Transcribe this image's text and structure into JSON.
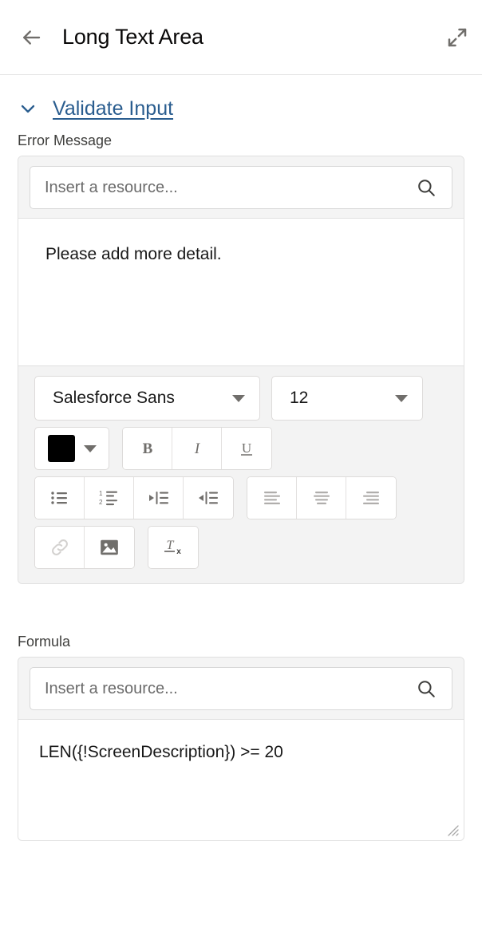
{
  "header": {
    "back_icon": "arrow-left-icon",
    "title": "Long Text Area",
    "expand_icon": "expand-diagonal-icon"
  },
  "section": {
    "chevron_icon": "chevron-down-icon",
    "link_label": "Validate Input"
  },
  "error_message": {
    "label": "Error Message",
    "resource_placeholder": "Insert a resource...",
    "resource_value": "",
    "search_icon": "search-icon",
    "body_text": "Please add more detail."
  },
  "toolbar": {
    "font_family": "Salesforce Sans",
    "font_size": "12",
    "text_color": "#000000",
    "buttons": [
      {
        "name": "bold-button",
        "label": "B"
      },
      {
        "name": "italic-button",
        "label": "I"
      },
      {
        "name": "underline-button",
        "label": "U"
      },
      {
        "name": "bulleted-list-button",
        "label": ""
      },
      {
        "name": "numbered-list-button",
        "label": ""
      },
      {
        "name": "indent-button",
        "label": ""
      },
      {
        "name": "outdent-button",
        "label": ""
      },
      {
        "name": "align-left-button",
        "label": ""
      },
      {
        "name": "align-center-button",
        "label": ""
      },
      {
        "name": "align-right-button",
        "label": ""
      },
      {
        "name": "link-button",
        "label": ""
      },
      {
        "name": "image-button",
        "label": ""
      },
      {
        "name": "remove-formatting-button",
        "label": ""
      }
    ]
  },
  "formula": {
    "label": "Formula",
    "resource_placeholder": "Insert a resource...",
    "resource_value": "",
    "search_icon": "search-icon",
    "expression": "LEN({!ScreenDescription}) >= 20"
  },
  "colors": {
    "link": "#2a5d8f",
    "text": "#181818",
    "label": "#3e3e3c",
    "border": "#e0e0e0",
    "toolbar_bg": "#f3f3f3",
    "icon_gray": "#706e6b",
    "icon_light": "#c9c7c5"
  }
}
